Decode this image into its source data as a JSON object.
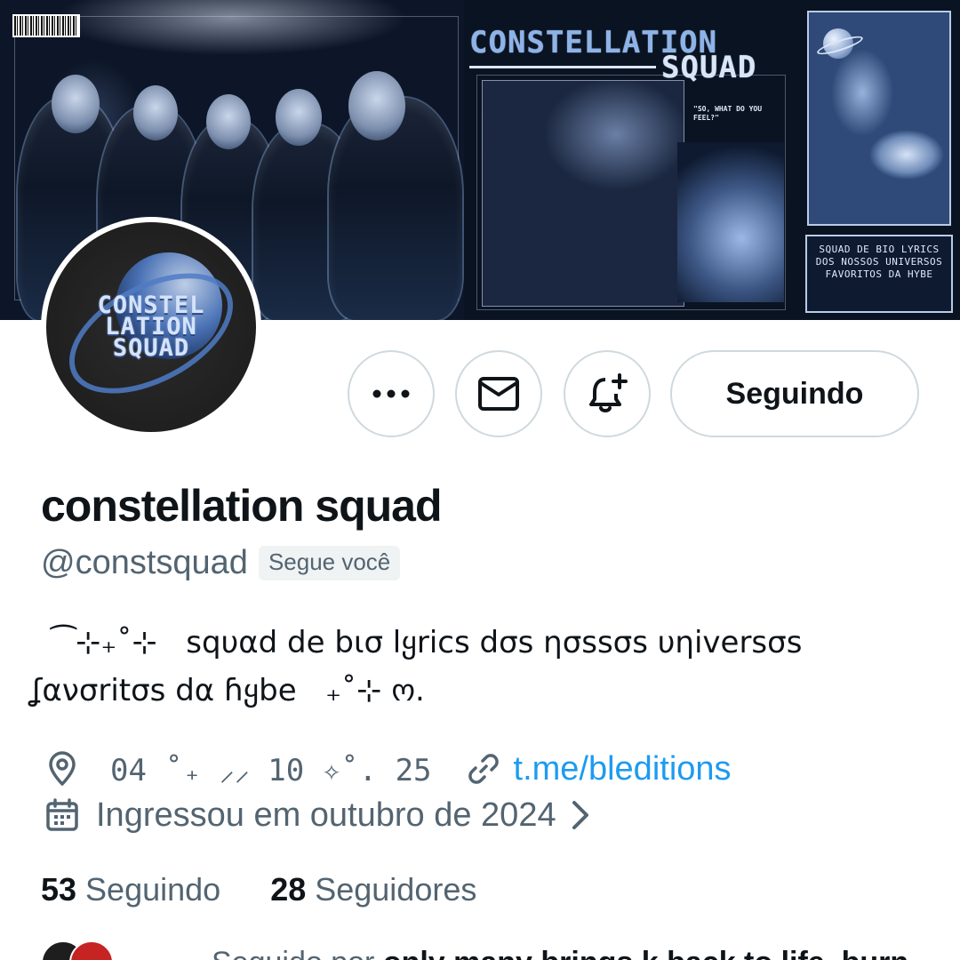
{
  "banner": {
    "title_line1": "CONSTELLATION",
    "title_line2": "SQUAD",
    "caption": "\"SO, WHAT DO YOU FEEL?\"",
    "note": "SQUAD DE BIO LYRICS DOS NOSSOS UNIVERSOS FAVORITOS DA HYBE",
    "barcode_text": "CONSTELLATIONSQUAD"
  },
  "avatar": {
    "logo_lines": [
      "CONSTEL",
      "LATION",
      "SQUAD"
    ]
  },
  "actions": {
    "more_icon": "more-icon",
    "message_icon": "envelope-icon",
    "notify_icon": "bell-plus-icon",
    "following_label": "Seguindo"
  },
  "profile": {
    "display_name": "constellation squad",
    "handle": "@constsquad",
    "follows_you": "Segue você",
    "bio_line1": "  ⁀⊹₊˚⊹   sqυαd de bισ lყrics dσs ησssσs υηiversσs",
    "bio_line2": "ʆανσritσs dα ɦყbe   ₊˚⊹ ო.",
    "location": "04 ˚₊ ⸝⸝ 10 ✧˚. 25",
    "link": "t.me/bleditions",
    "joined": "Ingressou em outubro de 2024"
  },
  "stats": {
    "following_count": "53",
    "following_label": "Seguindo",
    "followers_count": "28",
    "followers_label": "Seguidores"
  },
  "followed_by": {
    "prefix": "Seguido por ",
    "names": "only many brings k back to life, burn"
  },
  "colors": {
    "link": "#1d9bf0",
    "secondary_text": "#536471",
    "border": "#cfd9de"
  }
}
